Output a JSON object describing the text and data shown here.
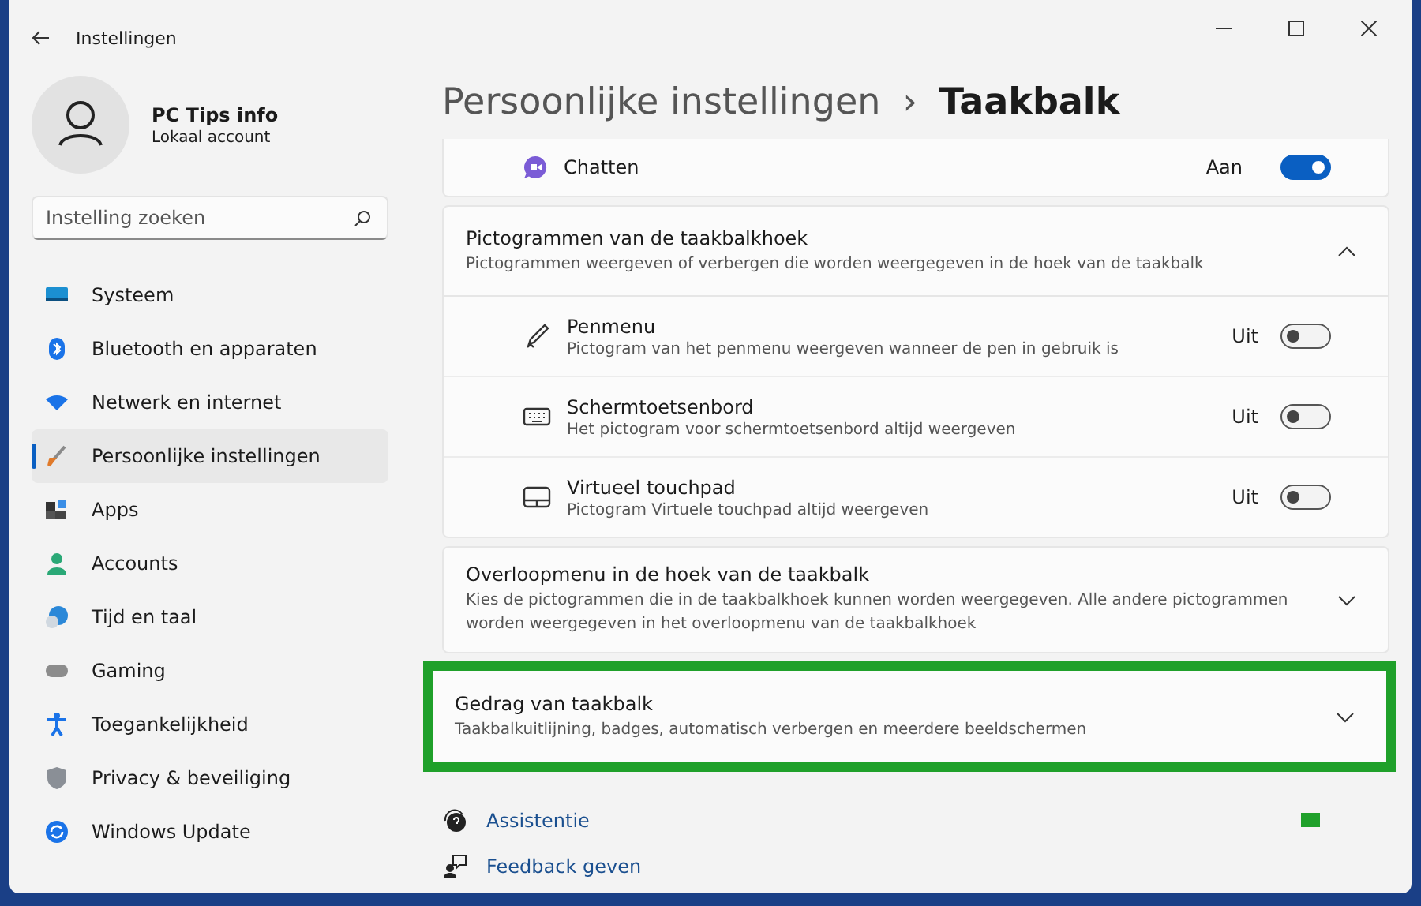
{
  "window": {
    "title": "Instellingen"
  },
  "user": {
    "name": "PC Tips info",
    "type": "Lokaal account"
  },
  "search": {
    "placeholder": "Instelling zoeken"
  },
  "sidebar": {
    "items": [
      {
        "label": "Systeem",
        "selected": false
      },
      {
        "label": "Bluetooth en apparaten",
        "selected": false
      },
      {
        "label": "Netwerk en internet",
        "selected": false
      },
      {
        "label": "Persoonlijke instellingen",
        "selected": true
      },
      {
        "label": "Apps",
        "selected": false
      },
      {
        "label": "Accounts",
        "selected": false
      },
      {
        "label": "Tijd en taal",
        "selected": false
      },
      {
        "label": "Gaming",
        "selected": false
      },
      {
        "label": "Toegankelijkheid",
        "selected": false
      },
      {
        "label": "Privacy & beveiliging",
        "selected": false
      },
      {
        "label": "Windows Update",
        "selected": false
      }
    ]
  },
  "breadcrumb": {
    "parent": "Persoonlijke instellingen",
    "separator": "›",
    "current": "Taakbalk"
  },
  "chat_row": {
    "label": "Chatten",
    "state": "Aan",
    "on": true
  },
  "corner_icons": {
    "title": "Pictogrammen van de taakbalkhoek",
    "description": "Pictogrammen weergeven of verbergen die worden weergegeven in de hoek van de taakbalk",
    "expanded": true,
    "items": [
      {
        "title": "Penmenu",
        "description": "Pictogram van het penmenu weergeven wanneer de pen in gebruik is",
        "state": "Uit",
        "on": false
      },
      {
        "title": "Schermtoetsenbord",
        "description": "Het pictogram voor schermtoetsenbord altijd weergeven",
        "state": "Uit",
        "on": false
      },
      {
        "title": "Virtueel touchpad",
        "description": "Pictogram Virtuele touchpad altijd weergeven",
        "state": "Uit",
        "on": false
      }
    ]
  },
  "expanders": [
    {
      "title": "Overloopmenu in de hoek van de taakbalk",
      "description": "Kies de pictogrammen die in de taakbalkhoek kunnen worden weergegeven. Alle andere pictogrammen worden weergegeven in het overloopmenu van de taakbalkhoek",
      "expanded": false,
      "highlighted": false
    },
    {
      "title": "Gedrag van taakbalk",
      "description": "Taakbalkuitlijning, badges, automatisch verbergen en meerdere beeldschermen",
      "expanded": false,
      "highlighted": true
    }
  ],
  "links": [
    {
      "label": "Assistentie"
    },
    {
      "label": "Feedback geven"
    }
  ]
}
